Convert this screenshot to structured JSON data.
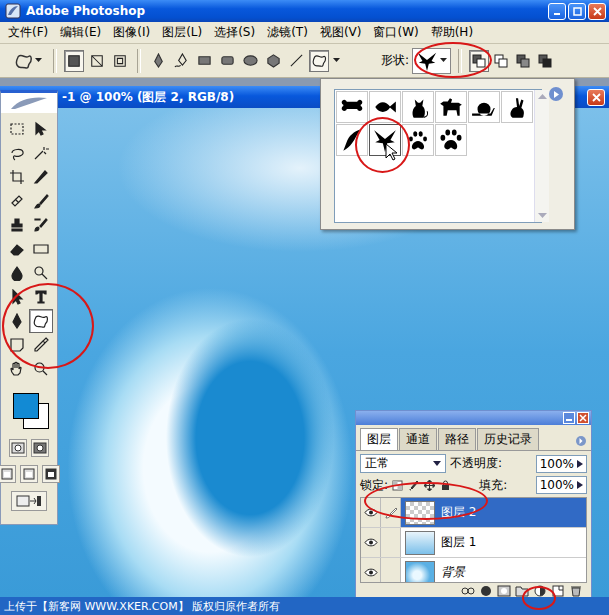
{
  "window": {
    "title": "Adobe Photoshop"
  },
  "menu": [
    "文件(F)",
    "编辑(E)",
    "图像(I)",
    "图层(L)",
    "选择(S)",
    "滤镜(T)",
    "视图(V)",
    "窗口(W)",
    "帮助(H)"
  ],
  "options_bar": {
    "shape_label": "形状:",
    "modes": [
      {
        "kind": "shape-layers",
        "selected": true
      },
      {
        "kind": "paths",
        "selected": false
      },
      {
        "kind": "fill-pixels",
        "selected": false
      }
    ],
    "tools": [
      {
        "kind": "pen",
        "selected": false
      },
      {
        "kind": "freeform-pen",
        "selected": false
      },
      {
        "kind": "rect",
        "selected": false
      },
      {
        "kind": "round-rect",
        "selected": false
      },
      {
        "kind": "ellipse",
        "selected": false
      },
      {
        "kind": "polygon",
        "selected": false
      },
      {
        "kind": "line",
        "selected": false
      },
      {
        "kind": "custom-shape",
        "selected": true
      }
    ]
  },
  "document": {
    "title": "-1 @ 100% (图层 2, RGB/8)"
  },
  "shape_picker": {
    "shapes": [
      {
        "kind": "bone",
        "selected": false
      },
      {
        "kind": "fish",
        "selected": false
      },
      {
        "kind": "cat",
        "selected": false
      },
      {
        "kind": "dog",
        "selected": false
      },
      {
        "kind": "snail",
        "selected": false
      },
      {
        "kind": "rabbit",
        "selected": false
      },
      {
        "kind": "bird",
        "selected": false
      },
      {
        "kind": "eagle",
        "selected": true
      },
      {
        "kind": "paw",
        "selected": false
      },
      {
        "kind": "paw2",
        "selected": false
      }
    ]
  },
  "toolbox": {
    "tools": [
      {
        "kind": "marquee",
        "selected": false
      },
      {
        "kind": "move",
        "selected": false
      },
      {
        "kind": "lasso",
        "selected": false
      },
      {
        "kind": "wand",
        "selected": false
      },
      {
        "kind": "crop",
        "selected": false
      },
      {
        "kind": "slice",
        "selected": false
      },
      {
        "kind": "heal",
        "selected": false
      },
      {
        "kind": "brush",
        "selected": false
      },
      {
        "kind": "stamp",
        "selected": false
      },
      {
        "kind": "history",
        "selected": false
      },
      {
        "kind": "eraser",
        "selected": false
      },
      {
        "kind": "gradient",
        "selected": false
      },
      {
        "kind": "blur",
        "selected": false
      },
      {
        "kind": "dodge",
        "selected": false
      },
      {
        "kind": "path-select",
        "selected": false
      },
      {
        "kind": "type",
        "selected": false
      },
      {
        "kind": "pen",
        "selected": false
      },
      {
        "kind": "custom-shape",
        "selected": true
      },
      {
        "kind": "notes",
        "selected": false
      },
      {
        "kind": "eyedropper",
        "selected": false
      },
      {
        "kind": "hand",
        "selected": false
      },
      {
        "kind": "zoom",
        "selected": false
      }
    ]
  },
  "layers_panel": {
    "tabs": [
      {
        "label": "图层",
        "selected": true
      },
      {
        "label": "通道",
        "selected": false
      },
      {
        "label": "路径",
        "selected": false
      },
      {
        "label": "历史记录",
        "selected": false
      }
    ],
    "blend_mode": "正常",
    "opacity_label": "不透明度:",
    "opacity": "100%",
    "lock_label": "锁定:",
    "fill_label": "填充:",
    "fill": "100%",
    "layers": [
      {
        "name": "图层 2",
        "selected": true,
        "visible": true,
        "kind": "empty"
      },
      {
        "name": "图层 1",
        "selected": false,
        "visible": true,
        "kind": "image"
      },
      {
        "name": "背景",
        "selected": false,
        "visible": true,
        "kind": "background"
      }
    ]
  },
  "status_bar": {
    "text": "上传于【新客网 WWW.XKER.COM】 版权归原作者所有"
  }
}
